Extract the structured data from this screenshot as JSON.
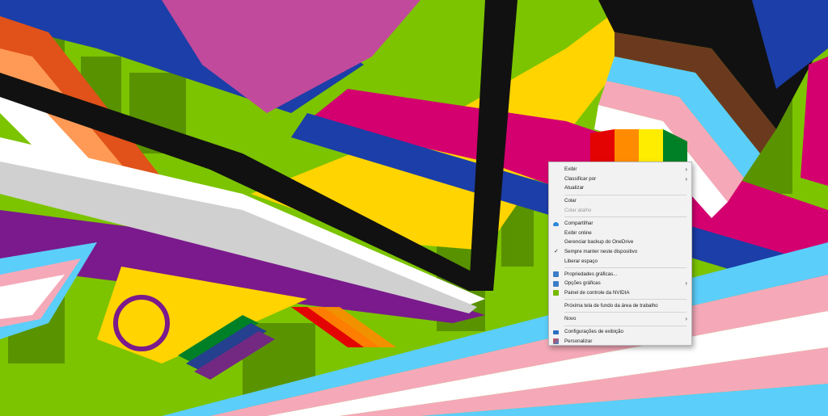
{
  "context_menu": {
    "items": [
      {
        "label": "Exibir",
        "submenu": true
      },
      {
        "label": "Classificar por",
        "submenu": true
      },
      {
        "label": "Atualizar"
      },
      {
        "separator": true
      },
      {
        "label": "Colar"
      },
      {
        "label": "Colar atalho",
        "disabled": true
      },
      {
        "separator": true
      },
      {
        "label": "Compartilhar",
        "icon": "onedrive-cloud-icon"
      },
      {
        "label": "Exibir online"
      },
      {
        "label": "Gerenciar backup do OneDrive"
      },
      {
        "label": "Sempre manter neste dispositivo",
        "checked": true
      },
      {
        "label": "Liberar espaço"
      },
      {
        "separator": true
      },
      {
        "label": "Propriedades gráficas...",
        "icon": "intel-graphics-icon"
      },
      {
        "label": "Opções gráficas",
        "icon": "intel-graphics-icon",
        "submenu": true
      },
      {
        "label": "Painel de controle da NVIDIA",
        "icon": "nvidia-icon"
      },
      {
        "separator": true
      },
      {
        "label": "Próxima tela de fundo da área de trabalho"
      },
      {
        "separator": true
      },
      {
        "label": "Novo",
        "submenu": true
      },
      {
        "separator": true
      },
      {
        "label": "Configurações de exibição",
        "icon": "display-settings-icon"
      },
      {
        "label": "Personalizar",
        "icon": "personalize-icon"
      }
    ],
    "submenu_glyph": "›",
    "check_glyph": "✓"
  },
  "wallpaper": {
    "description_colors": [
      "#d4006f",
      "#1c3ea8",
      "#ffd400",
      "#7a1a8c",
      "#8bd400",
      "#ff8c1a",
      "#ffffff",
      "#5bcefa",
      "#f5a9b8",
      "#000000",
      "#6b3a1e"
    ]
  }
}
